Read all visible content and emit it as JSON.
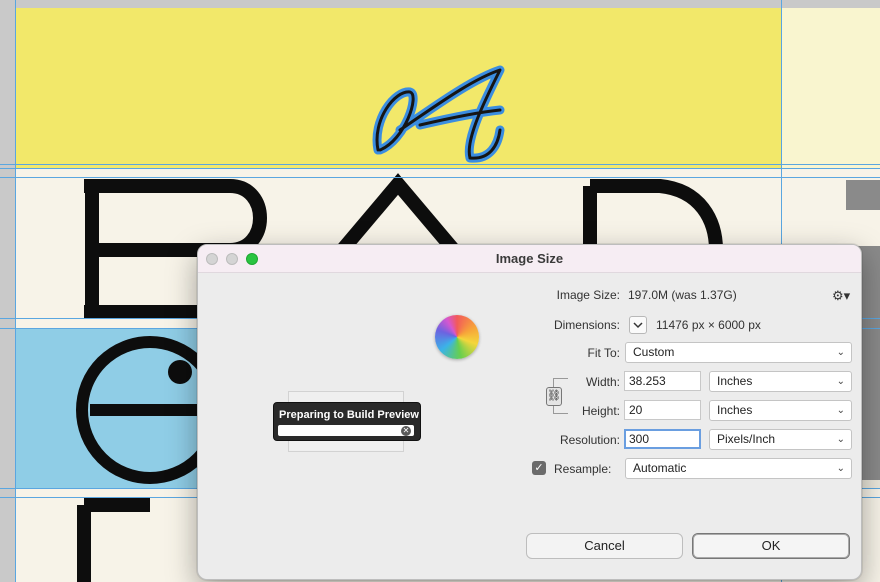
{
  "dialog": {
    "title": "Image Size",
    "image_size_label": "Image Size:",
    "image_size_value": "197.0M (was 1.37G)",
    "dimensions_label": "Dimensions:",
    "dimensions_value": "11476 px  ×  6000 px",
    "fit_to_label": "Fit To:",
    "fit_to_value": "Custom",
    "width_label": "Width:",
    "width_value": "38.253",
    "width_unit": "Inches",
    "height_label": "Height:",
    "height_value": "20",
    "height_unit": "Inches",
    "resolution_label": "Resolution:",
    "resolution_value": "300",
    "resolution_unit": "Pixels/Inch",
    "resample_label": "Resample:",
    "resample_checked": true,
    "resample_value": "Automatic",
    "cancel_label": "Cancel",
    "ok_label": "OK"
  },
  "preview": {
    "status_label": "Preparing to Build Preview"
  },
  "canvas_art": {
    "script_letter": "A",
    "block_letters": [
      "B",
      "A",
      "D"
    ]
  },
  "icons": {
    "gear": "gear-icon",
    "link": "link-icon",
    "chevron": "chevron-down-icon",
    "spinner": "spinning-wheel-icon",
    "cancel_progress": "cancel-circle-icon"
  },
  "colors": {
    "canvas_yellow": "#f2e86a",
    "canvas_cream": "#f7f3e8",
    "canvas_blue": "#8fcde6",
    "guide_blue": "#5aa6e0",
    "zoom_green": "#29c440"
  }
}
